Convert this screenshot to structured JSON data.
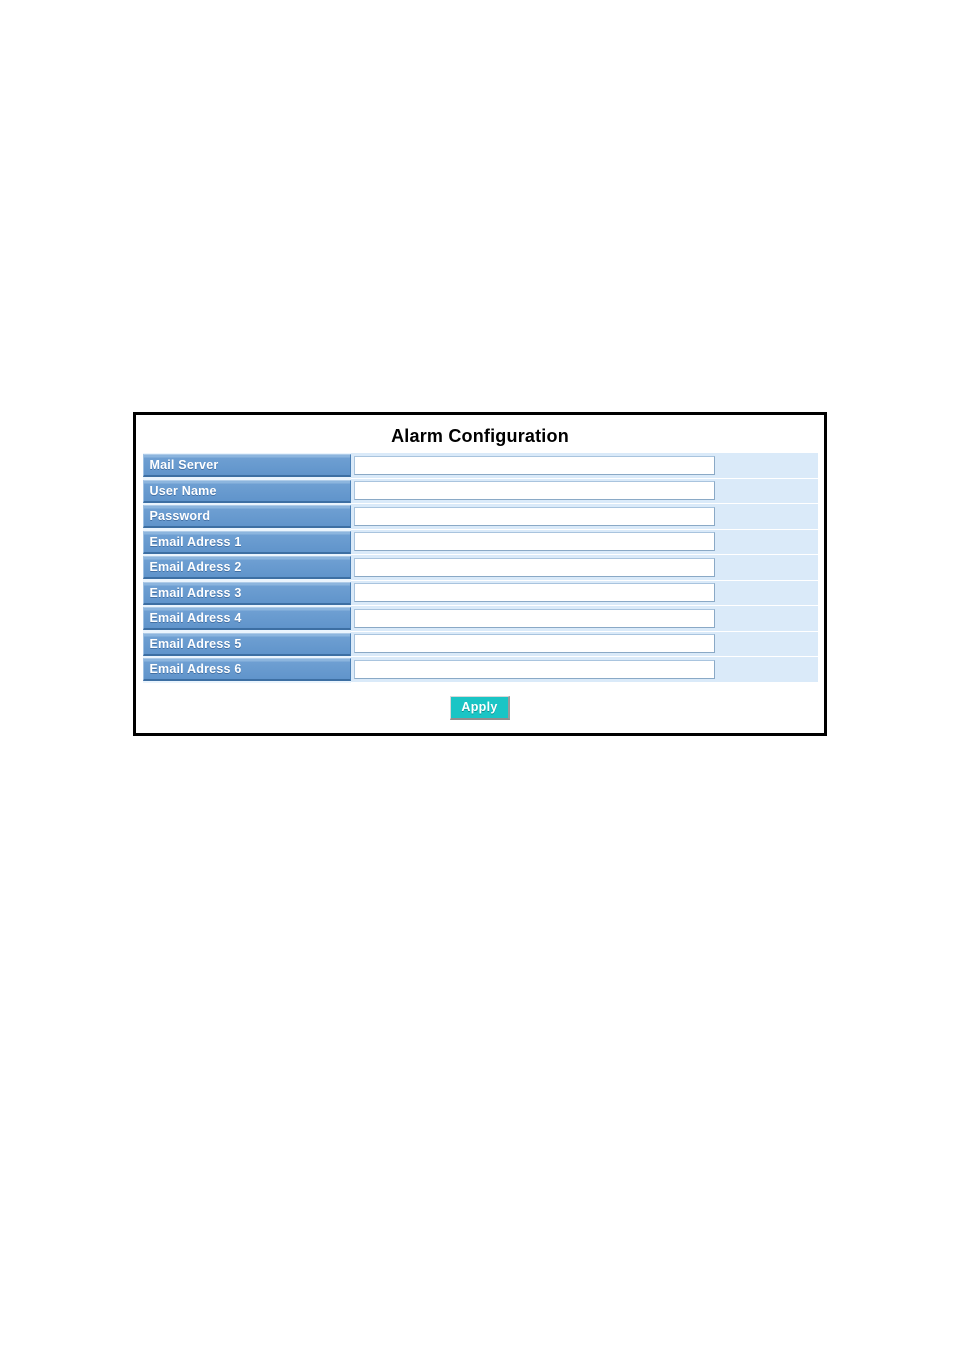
{
  "panel": {
    "title": "Alarm Configuration",
    "rows": [
      {
        "label": "Mail Server",
        "value": "",
        "placeholder": ""
      },
      {
        "label": "User Name",
        "value": "",
        "placeholder": ""
      },
      {
        "label": "Password",
        "value": "",
        "placeholder": ""
      },
      {
        "label": "Email Adress 1",
        "value": "",
        "placeholder": ""
      },
      {
        "label": "Email Adress 2",
        "value": "",
        "placeholder": ""
      },
      {
        "label": "Email Adress 3",
        "value": "",
        "placeholder": ""
      },
      {
        "label": "Email Adress 4",
        "value": "",
        "placeholder": ""
      },
      {
        "label": "Email Adress 5",
        "value": "",
        "placeholder": ""
      },
      {
        "label": "Email Adress 6",
        "value": "",
        "placeholder": ""
      }
    ],
    "apply_label": "Apply"
  },
  "colors": {
    "label_blue": "#6a9ed4",
    "row_light_blue": "#daeaf9",
    "apply_teal": "#1ac5c5",
    "panel_border": "#000000",
    "label_text": "#ffffff",
    "title_text": "#000000"
  }
}
